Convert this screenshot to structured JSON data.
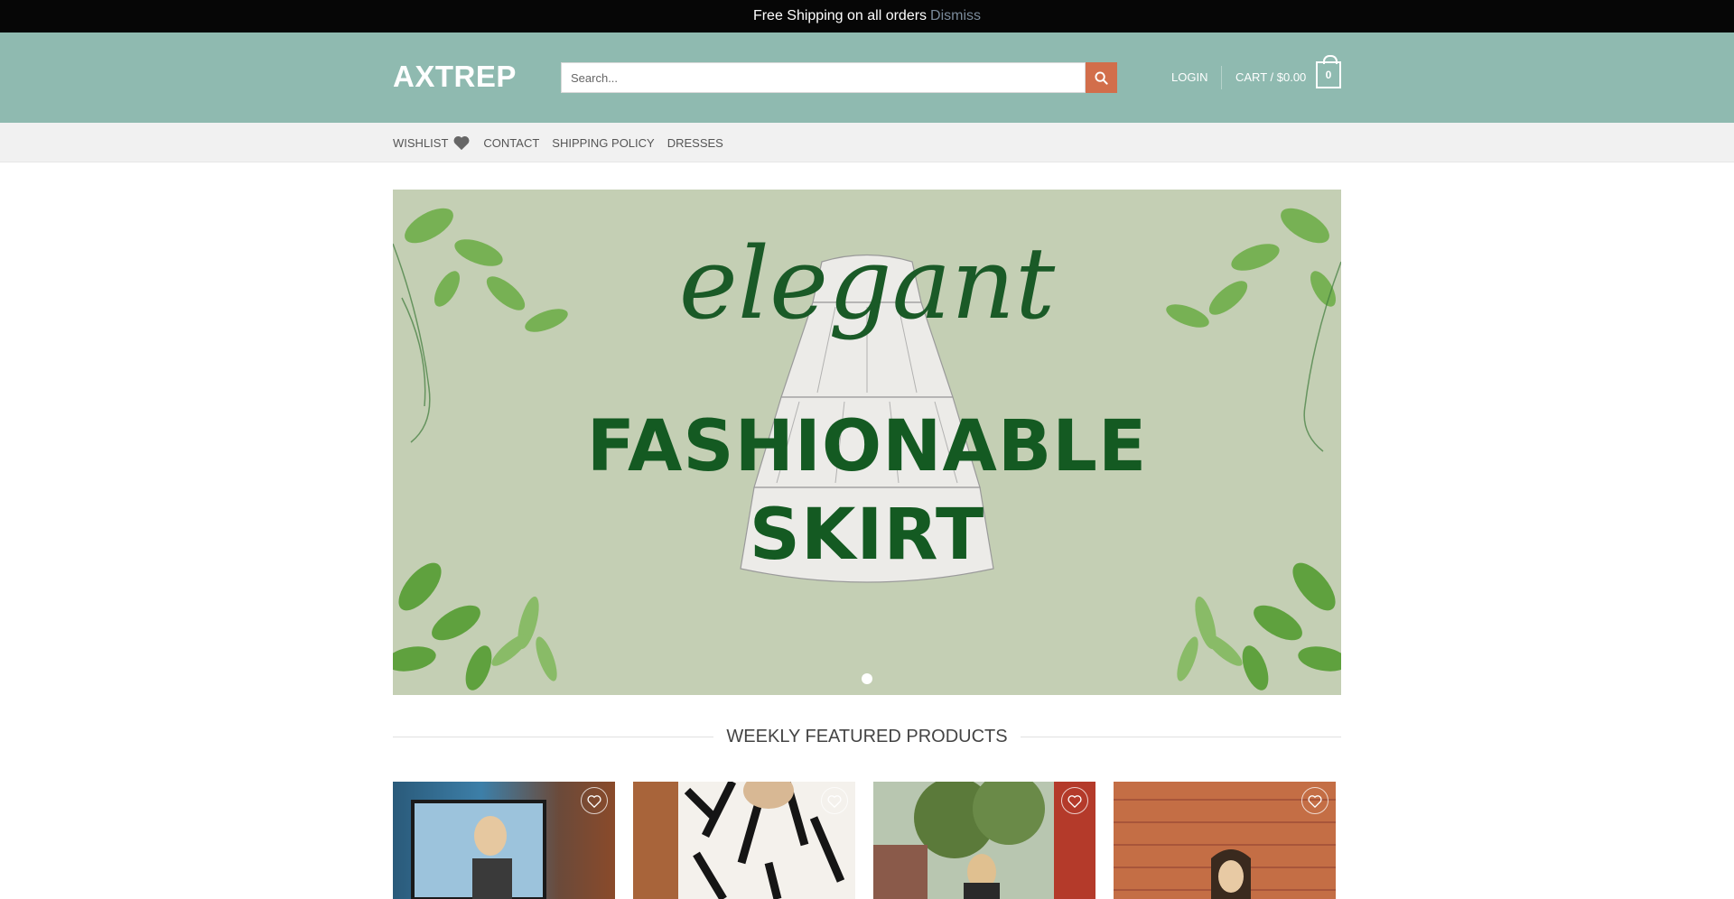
{
  "announcement": {
    "text": "Free Shipping on all orders",
    "dismiss": "Dismiss"
  },
  "header": {
    "logo": "AXTREP",
    "search_placeholder": "Search...",
    "login": "LOGIN",
    "cart_label": "CART / $0.00",
    "cart_count": "0"
  },
  "nav": {
    "items": [
      {
        "label": "WISHLIST",
        "icon": "heart-icon"
      },
      {
        "label": "CONTACT"
      },
      {
        "label": "SHIPPING POLICY"
      },
      {
        "label": "DRESSES"
      }
    ]
  },
  "hero": {
    "script_text": "elegant",
    "line1": "FASHIONABLE",
    "line2": "SKIRT"
  },
  "featured": {
    "title": "WEEKLY FEATURED PRODUCTS"
  },
  "colors": {
    "header_bg": "#8fbab0",
    "accent": "#d26e4b",
    "hero_bg": "#c4cfb4",
    "hero_text": "#145a22"
  }
}
